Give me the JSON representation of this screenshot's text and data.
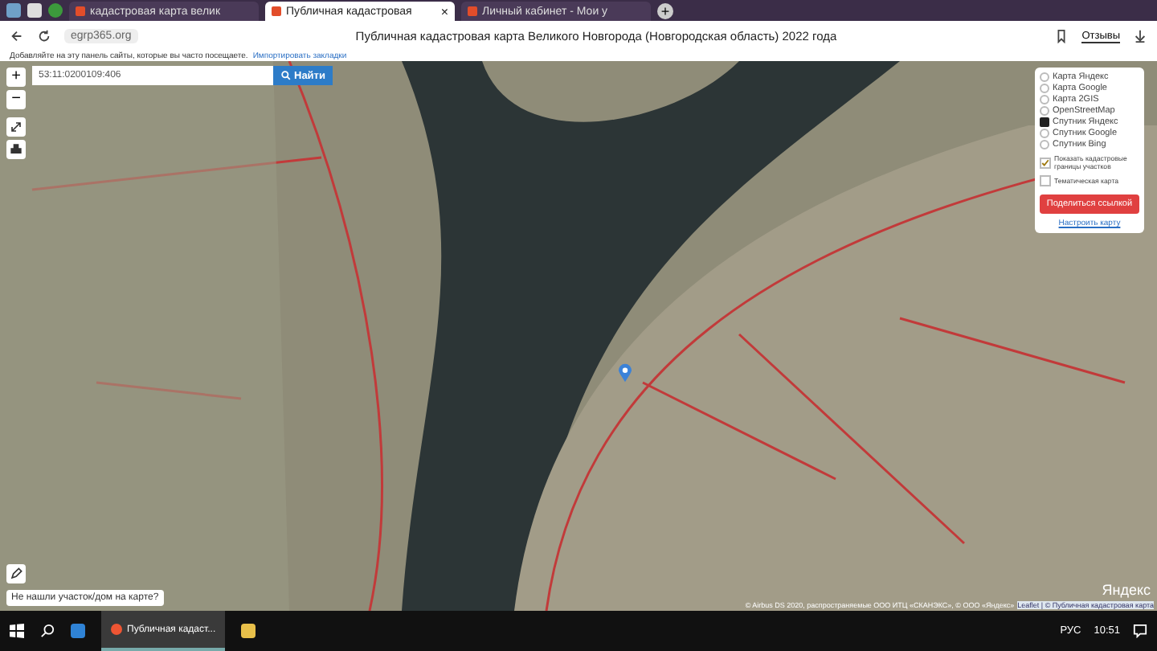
{
  "browser": {
    "tabs": [
      {
        "label": "кадастровая карта велик",
        "selected": false
      },
      {
        "label": "Публичная кадастровая",
        "selected": true,
        "close": "×"
      },
      {
        "label": "Личный кабинет - Мои у",
        "selected": false
      }
    ],
    "new_tab": "+",
    "url": "egrp365.org",
    "page_title": "Публичная кадастровая карта Великого Новгорода (Новгородская область) 2022 года",
    "reviews": "Отзывы",
    "bookmarks_hint": "Добавляйте на эту панель сайты, которые вы часто посещаете.",
    "bookmarks_link": "Импортировать закладки"
  },
  "map": {
    "zoom_in": "+",
    "zoom_out": "−",
    "search": {
      "value": "53:11:0200109:406"
    },
    "search_button": "Найти",
    "layers": [
      {
        "label": "Карта Яндекс",
        "selected": false
      },
      {
        "label": "Карта Google",
        "selected": false
      },
      {
        "label": "Карта 2GIS",
        "selected": false
      },
      {
        "label": "OpenStreetMap",
        "selected": false
      },
      {
        "label": "Спутник Яндекс",
        "selected": true
      },
      {
        "label": "Спутник Google",
        "selected": false
      },
      {
        "label": "Спутник Bing",
        "selected": false
      }
    ],
    "options": [
      {
        "label": "Показать кадастровые границы участков",
        "checked": true
      },
      {
        "label": "Тематическая карта",
        "checked": false
      }
    ],
    "share_button": "Поделиться ссылкой",
    "configure_link": "Настроить карту",
    "not_found": "Не нашли участок/дом на карте?",
    "attribution": "© Airbus DS 2020, распространяемые ООО ИТЦ «СКАНЭКС», © ООО «Яндекс»",
    "leaflet": "Leaflet | © Публичная кадастровая карта",
    "yandex": "Яндекс"
  },
  "taskbar": {
    "app": "Публичная кадаст...",
    "language": "РУС",
    "time": "10:51"
  }
}
